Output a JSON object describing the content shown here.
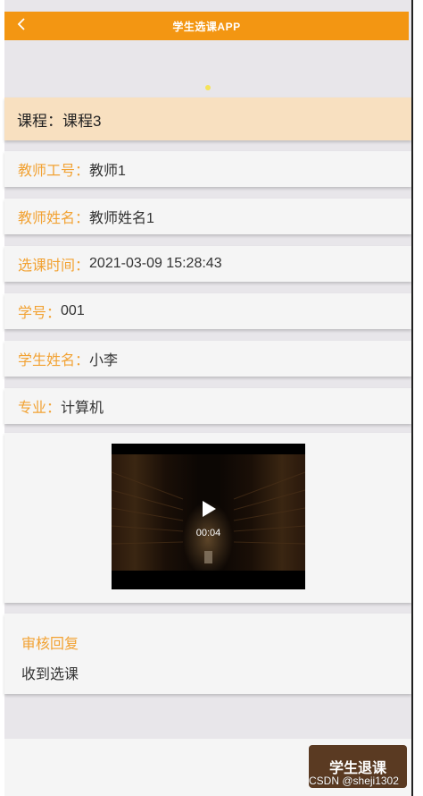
{
  "header": {
    "title": "学生选课APP",
    "back_icon": "chevron-left-icon",
    "color": "#f39612"
  },
  "course": {
    "label": "课程：",
    "value": "课程3",
    "bg_color": "#f8e0c0"
  },
  "info_rows": [
    {
      "label": "教师工号：",
      "value": "教师1"
    },
    {
      "label": "教师姓名：",
      "value": "教师姓名1"
    },
    {
      "label": "选课时间：",
      "value": "2021-03-09 15:28:43"
    },
    {
      "label": "学号：",
      "value": "001"
    },
    {
      "label": "学生姓名：",
      "value": "小李"
    },
    {
      "label": "专业：",
      "value": "计算机"
    }
  ],
  "video": {
    "time": "00:04",
    "play_icon": "play-icon"
  },
  "review": {
    "title": "审核回复",
    "content": "收到选课"
  },
  "actions": {
    "withdraw_label": "学生退课",
    "button_color": "#5a3a22"
  },
  "watermark": "CSDN @sheji1302",
  "colors": {
    "label": "#f2a233",
    "value": "#333333"
  }
}
